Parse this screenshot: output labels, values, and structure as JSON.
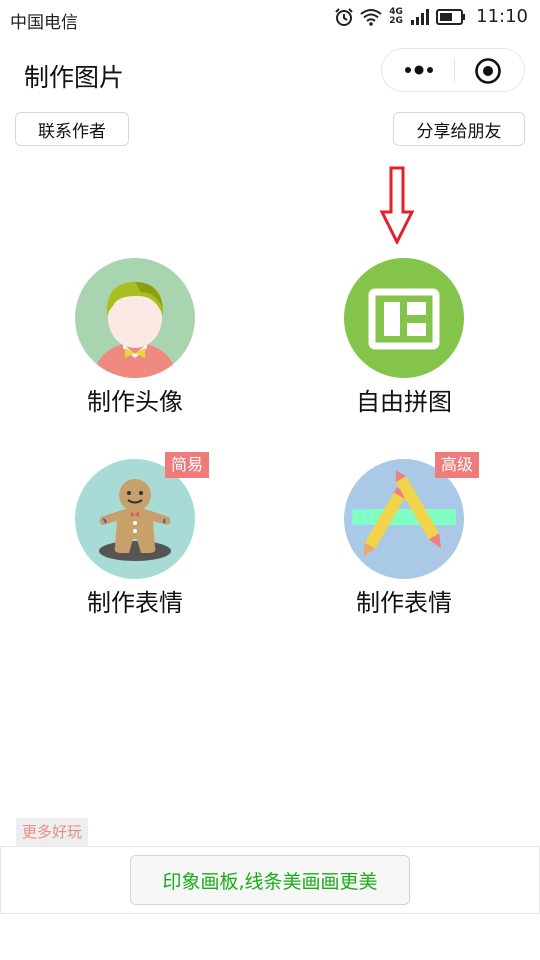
{
  "status_bar": {
    "carrier": "中国电信",
    "network": "4G 2G",
    "time": "11:10"
  },
  "nav": {
    "title": "制作图片"
  },
  "actions": {
    "contact": "联系作者",
    "share": "分享给朋友"
  },
  "tiles": [
    {
      "label": "制作头像",
      "badge": ""
    },
    {
      "label": "自由拼图",
      "badge": ""
    },
    {
      "label": "制作表情",
      "badge": "简易"
    },
    {
      "label": "制作表情",
      "badge": "高级"
    }
  ],
  "footer": {
    "tag": "更多好玩",
    "promo": "印象画板,线条美画画更美"
  },
  "colors": {
    "promo_text": "#1aad19",
    "badge_bg": "#f07b7b",
    "arrow": "#e1202a",
    "collage_circle": "#84c44a"
  }
}
